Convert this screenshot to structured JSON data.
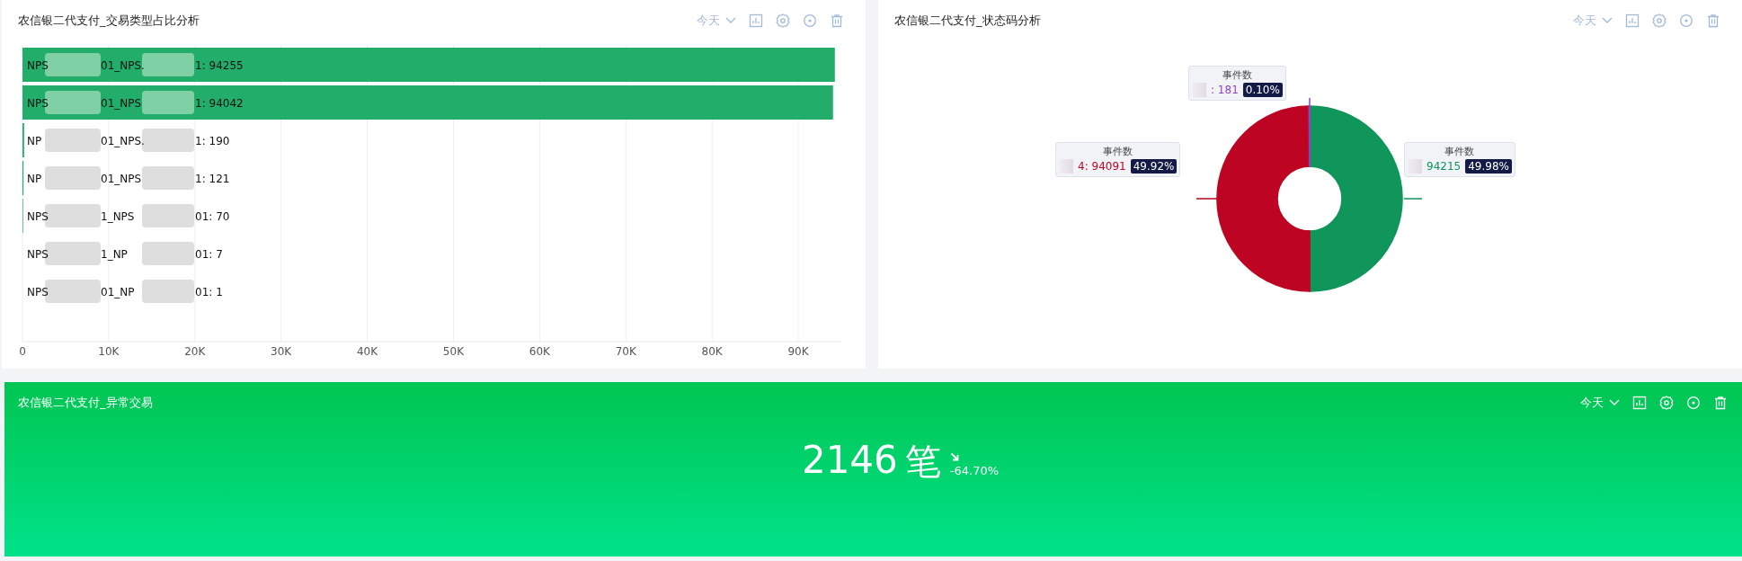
{
  "panels": [
    {
      "kind": "bar",
      "title": "农信银二代支付_交易类型占比分析",
      "range": "今天",
      "bar_labels": [
        {
          "parts": [
            "NPS",
            "01_NPS.",
            "1: 94255"
          ]
        },
        {
          "parts": [
            "NPS",
            "01_NPS",
            "1: 94042"
          ]
        },
        {
          "parts": [
            "NP",
            "01_NPS.",
            "1: 190"
          ]
        },
        {
          "parts": [
            "NP",
            "01_NPS",
            "1: 121"
          ]
        },
        {
          "parts": [
            "NPS",
            "1_NPS",
            "01: 70"
          ]
        },
        {
          "parts": [
            "NPS",
            "1_NP",
            "01: 7"
          ]
        },
        {
          "parts": [
            "NPS",
            "01_NP",
            "01: 1"
          ]
        }
      ],
      "chart_data": {
        "type": "bar",
        "orientation": "horizontal",
        "grid": true,
        "xlim": [
          0,
          95000
        ],
        "values": [
          94255,
          94042,
          190,
          121,
          70,
          7,
          1
        ],
        "xticks": [
          {
            "value": 0,
            "label": "0"
          },
          {
            "value": 10000,
            "label": "10K"
          },
          {
            "value": 20000,
            "label": "20K"
          },
          {
            "value": 30000,
            "label": "30K"
          },
          {
            "value": 40000,
            "label": "40K"
          },
          {
            "value": 50000,
            "label": "50K"
          },
          {
            "value": 60000,
            "label": "60K"
          },
          {
            "value": 70000,
            "label": "70K"
          },
          {
            "value": 80000,
            "label": "80K"
          },
          {
            "value": 90000,
            "label": "90K"
          }
        ]
      }
    },
    {
      "kind": "donut",
      "title": "农信银二代支付_状态码分析",
      "range": "今天",
      "callouts": [
        {
          "header": "事件数",
          "value": ": 181",
          "percent": "0.10%",
          "color": "#8e44c8"
        },
        {
          "header": "事件数",
          "value": "4: 94091",
          "percent": "49.92%",
          "color": "#bd0523"
        },
        {
          "header": "事件数",
          "value": "94215",
          "percent": "49.98%",
          "color": "#10955a"
        }
      ],
      "chart_data": {
        "type": "donut",
        "values": [
          0.1,
          49.92,
          49.98
        ]
      }
    },
    {
      "kind": "stat",
      "title": "农信银二代支付_异常交易",
      "range": "今天",
      "value": "2146",
      "unit": "笔",
      "change": "-64.70%"
    }
  ]
}
